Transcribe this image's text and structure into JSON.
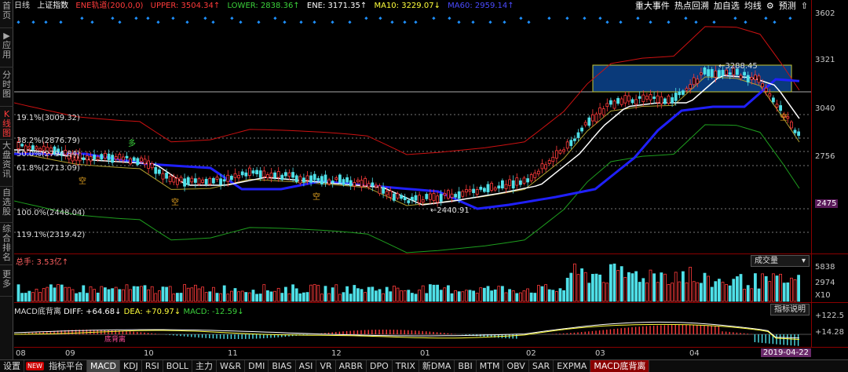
{
  "window": {
    "period": "日线",
    "index_name": "上证指数"
  },
  "indicators": {
    "ene_label": "ENE轨道(200,0,0)",
    "upper": "UPPER: 3504.34↑",
    "lower": "LOWER: 2838.36↑",
    "ene": "ENE: 3171.35↑",
    "ma10": "MA10: 3229.07↓",
    "ma60": "MA60: 2959.14↑"
  },
  "top_menu": [
    "重大事件",
    "热点回溯",
    "加自选",
    "均线",
    "预测"
  ],
  "left_rail": [
    "首页",
    "应用",
    "分时图",
    "K线图",
    "大盘资讯",
    "自选股",
    "综合排名",
    "更多"
  ],
  "price_axis": [
    "3602",
    "3321",
    "3040",
    "2756",
    "2475"
  ],
  "fib_levels": [
    "19.1%(3009.32)",
    "38.2%(2876.79)",
    "50.0%(2794.84)",
    "61.8%(2713.09)",
    "100.0%(2448.04)",
    "119.1%(2319.42)"
  ],
  "annotations": {
    "high": "3288.45",
    "low": "2440.91",
    "kong": "空",
    "duo": "多"
  },
  "volume": {
    "label": "总手: 3.53亿↑",
    "selector": "成交量",
    "axis": [
      "5838",
      "2974",
      "X10"
    ]
  },
  "macd": {
    "label": "MACD底背离",
    "diff": "DIFF: +64.68↓",
    "dea": "DEA: +70.97↓",
    "macd": "MACD: -12.59↓",
    "help": "指标说明",
    "axis": [
      "+122.5",
      "+14.28"
    ],
    "divergence": "底背离"
  },
  "date_axis": [
    "08",
    "09",
    "10",
    "11",
    "12",
    "01",
    "02",
    "03",
    "04"
  ],
  "date_cursor": "2019-04-22",
  "bottom_tabs": [
    "设置",
    "NEW",
    "指标平台",
    "MACD",
    "KDJ",
    "RSI",
    "BOLL",
    "主力",
    "W&R",
    "DMI",
    "BIAS",
    "ASI",
    "VR",
    "ARBR",
    "DPO",
    "TRIX",
    "新DMA",
    "BBI",
    "MTM",
    "OBV",
    "SAR",
    "EXPMA",
    "MACD底背离"
  ],
  "colors": {
    "up": "#ff3b3b",
    "down": "#4fe0e8",
    "ma10": "#ffffff",
    "ma60": "#2020ff",
    "upper": "#cc1111",
    "lower": "#1e9e1e",
    "ene": "#b0a030",
    "highlight_box": "#0a3a7a"
  }
}
